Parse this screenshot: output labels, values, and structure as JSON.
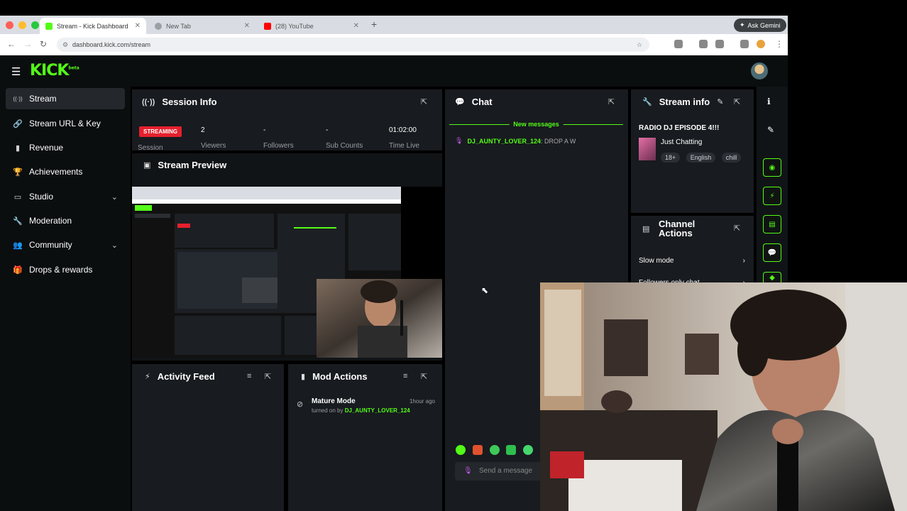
{
  "browser": {
    "tabs": [
      {
        "label": "Stream - Kick Dashboard",
        "active": true
      },
      {
        "label": "New Tab",
        "active": false
      },
      {
        "label": "(28) YouTube",
        "active": false
      }
    ],
    "new_tab_symbol": "+",
    "gemini_label": "Ask Gemini",
    "url": "dashboard.kick.com/stream"
  },
  "header": {
    "logo": "KICK",
    "logo_badge": "beta"
  },
  "sidebar": {
    "items": [
      {
        "label": "Stream",
        "icon": "stream-icon",
        "glyph": "((·))",
        "active": true,
        "expandable": false
      },
      {
        "label": "Stream URL & Key",
        "icon": "link-icon",
        "glyph": "🔗",
        "active": false,
        "expandable": false
      },
      {
        "label": "Revenue",
        "icon": "chart-icon",
        "glyph": "▮",
        "active": false,
        "expandable": false
      },
      {
        "label": "Achievements",
        "icon": "trophy-icon",
        "glyph": "🏆",
        "active": false,
        "expandable": false
      },
      {
        "label": "Studio",
        "icon": "studio-icon",
        "glyph": "▭",
        "active": false,
        "expandable": true
      },
      {
        "label": "Moderation",
        "icon": "wrench-icon",
        "glyph": "🔧",
        "active": false,
        "expandable": false
      },
      {
        "label": "Community",
        "icon": "people-icon",
        "glyph": "👥",
        "active": false,
        "expandable": true
      },
      {
        "label": "Drops & rewards",
        "icon": "gift-icon",
        "glyph": "🎁",
        "active": false,
        "expandable": false
      }
    ]
  },
  "session_info": {
    "title": "Session Info",
    "status_badge": "STREAMING",
    "session_label": "Session",
    "stats": [
      {
        "value": "2",
        "label": "Viewers"
      },
      {
        "value": "-",
        "label": "Followers"
      },
      {
        "value": "-",
        "label": "Sub Counts"
      },
      {
        "value": "01:02:00",
        "label": "Time Live"
      }
    ]
  },
  "stream_preview": {
    "title": "Stream Preview"
  },
  "activity_feed": {
    "title": "Activity Feed"
  },
  "mod_actions": {
    "title": "Mod Actions",
    "items": [
      {
        "action": "Mature Mode",
        "time": "1hour ago",
        "detail_prefix": "turned on by",
        "user": "DJ_AUNTY_LOVER_124"
      }
    ]
  },
  "chat": {
    "title": "Chat",
    "new_messages_label": "New messages",
    "messages": [
      {
        "user": "DJ_AUNTY_LOVER_124",
        "text": ": DROP A W"
      }
    ],
    "input_placeholder": "Send a message"
  },
  "stream_info": {
    "title": "Stream info",
    "stream_title": "RADIO DJ EPISODE 4!!!",
    "category": "Just Chatting",
    "tags": [
      "18+",
      "English",
      "chill"
    ]
  },
  "channel_actions": {
    "title": "Channel Actions",
    "rows": [
      {
        "label": "Slow mode"
      },
      {
        "label": "Followers only chat"
      }
    ]
  },
  "colors": {
    "kick_green": "#53fc18",
    "panel_bg": "#181b1f",
    "streaming_red": "#e5202e"
  }
}
